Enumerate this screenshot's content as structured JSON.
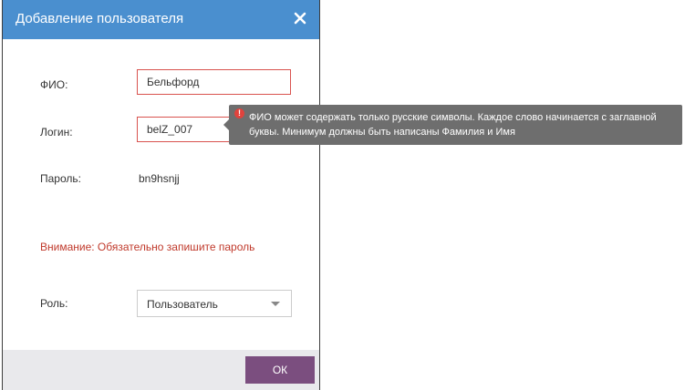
{
  "dialog": {
    "title": "Добавление пользователя",
    "close_icon": "close-icon"
  },
  "form": {
    "fio": {
      "label": "ФИО:",
      "value": "Бельфорд"
    },
    "login": {
      "label": "Логин:",
      "value": "belZ_007"
    },
    "password": {
      "label": "Пароль:",
      "value": "bn9hsnjj"
    },
    "warning": "Внимание: Обязательно запишите пароль",
    "role": {
      "label": "Роль:",
      "selected": "Пользователь"
    }
  },
  "footer": {
    "ok_label": "ОК"
  },
  "tooltip": {
    "icon": "error-icon",
    "text": "ФИО может содержать только русские символы. Каждое слово начинается с заглавной буквы. Минимум должны быть написаны Фамилия и Имя"
  },
  "colors": {
    "titlebar": "#4a8fcf",
    "error_border": "#d9534f",
    "warning_text": "#c0392b",
    "ok_button": "#7b4e7f",
    "tooltip_bg": "#6e6e6e"
  }
}
